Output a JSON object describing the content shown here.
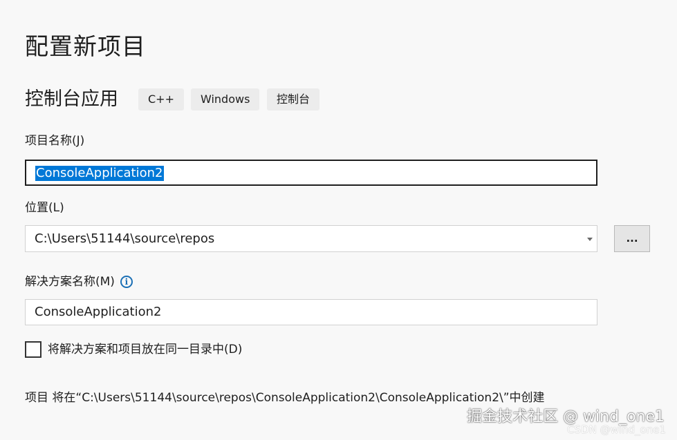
{
  "page_title": "配置新项目",
  "template": {
    "name": "控制台应用",
    "tags": [
      "C++",
      "Windows",
      "控制台"
    ]
  },
  "project_name": {
    "label": "项目名称(J)",
    "value": "ConsoleApplication2"
  },
  "location": {
    "label": "位置(L)",
    "value": "C:\\Users\\51144\\source\\repos",
    "browse_label": "..."
  },
  "solution_name": {
    "label": "解决方案名称(M)",
    "info_icon": "info-icon",
    "value": "ConsoleApplication2"
  },
  "same_directory": {
    "label": "将解决方案和项目放在同一目录中(D)",
    "checked": false
  },
  "path_note": "项目 将在“C:\\Users\\51144\\source\\repos\\ConsoleApplication2\\ConsoleApplication2\\”中创建",
  "watermark": {
    "line1": "掘金技术社区 @ wind_one1",
    "line2": "CSDN @wind_one1"
  },
  "colors": {
    "background": "#f8f8f8",
    "selection": "#0078d7",
    "info": "#1a6fb5"
  }
}
